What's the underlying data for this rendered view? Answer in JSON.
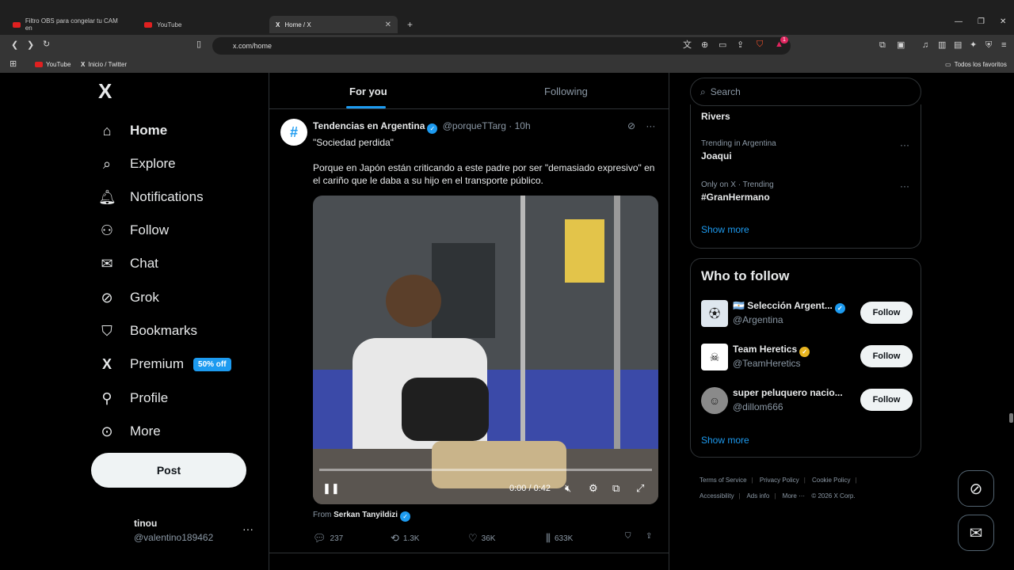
{
  "browser": {
    "tabs": [
      {
        "label": "Filtro OBS para congelar tu CAM en"
      },
      {
        "label": "YouTube"
      },
      {
        "label": "Home / X"
      }
    ],
    "new_tab": "+",
    "url": "x.com/home",
    "bookmarks": [
      {
        "label": "YouTube"
      },
      {
        "label": "Inicio / Twitter"
      }
    ],
    "bookmarks_right": "Todos los favoritos",
    "notif_count": "1"
  },
  "nav": {
    "logo": "X",
    "items": [
      {
        "label": "Home",
        "icon": "house-icon"
      },
      {
        "label": "Explore",
        "icon": "search-icon"
      },
      {
        "label": "Notifications",
        "icon": "bell-icon"
      },
      {
        "label": "Follow",
        "icon": "person-add-icon"
      },
      {
        "label": "Chat",
        "icon": "envelope-icon"
      },
      {
        "label": "Grok",
        "icon": "grok-icon"
      },
      {
        "label": "Bookmarks",
        "icon": "bookmark-icon"
      },
      {
        "label": "Premium",
        "icon": "x-icon"
      },
      {
        "label": "Profile",
        "icon": "person-icon"
      },
      {
        "label": "More",
        "icon": "more-circle-icon"
      }
    ],
    "premium_badge": "50% off",
    "post_label": "Post",
    "account": {
      "name": "tinou",
      "handle": "@valentino189462"
    }
  },
  "feed": {
    "tab_for_you": "For you",
    "tab_following": "Following",
    "tweet": {
      "author": "Tendencias en Argentina",
      "handle": "@porqueTTarg",
      "time": "· 10h",
      "line1": "\"Sociedad perdida\"",
      "line2": "Porque en Japón están criticando a este padre por ser \"demasiado expresivo\" en el cariño que le daba a su hijo en el transporte público.",
      "video_time": "0:00 / 0:42",
      "from_prefix": "From",
      "from_name": "Serkan Tanyildizi",
      "stats": {
        "replies": "237",
        "reposts": "1.3K",
        "likes": "36K",
        "views": "633K"
      }
    }
  },
  "sidebar": {
    "search_placeholder": "Search",
    "trends": [
      {
        "meta": "",
        "title": "Rivers"
      },
      {
        "meta": "Trending in Argentina",
        "title": "Joaqui"
      },
      {
        "meta": "Only on X · Trending",
        "title": "#GranHermano"
      }
    ],
    "show_more": "Show more",
    "who_to_follow_title": "Who to follow",
    "who_to_follow": [
      {
        "name": "🇦🇷 Selección Argent...",
        "handle": "@Argentina"
      },
      {
        "name": "Team Heretics",
        "handle": "@TeamHeretics"
      },
      {
        "name": "super peluquero nacio...",
        "handle": "@dillom666"
      }
    ],
    "follow_label": "Follow",
    "footer": [
      "Terms of Service",
      "Privacy Policy",
      "Cookie Policy",
      "Accessibility",
      "Ads info",
      "More ···",
      "© 2026 X Corp."
    ]
  },
  "colors": {
    "accent": "#1d9bf0",
    "background": "#000000",
    "text": "#e7e9ea",
    "muted": "#8b98a5"
  }
}
